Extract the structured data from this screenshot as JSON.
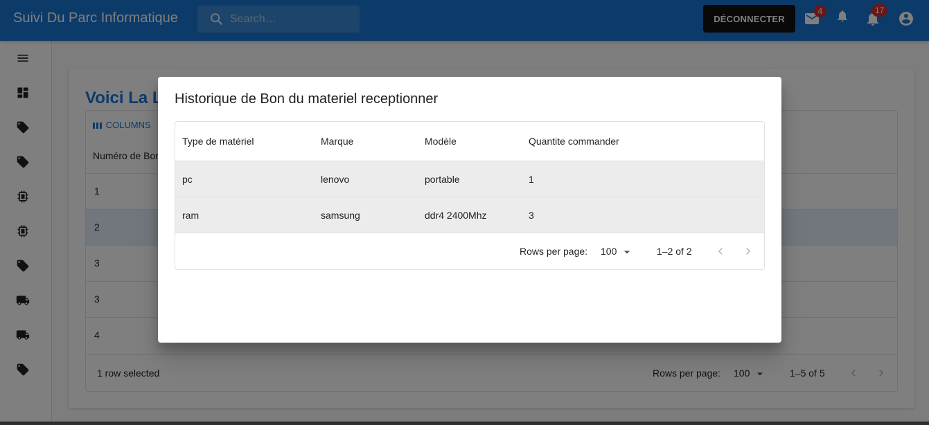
{
  "app": {
    "title": "Suivi Du Parc Informatique",
    "search_placeholder": "Search…",
    "logout_label": "DÉCONNECTER",
    "mail_badge": "4",
    "notifications_badge": "17"
  },
  "page": {
    "title": "Voici La L",
    "columns_label": "COLUMNS",
    "column_header": "Numéro de Bon",
    "rows": [
      "1",
      "2",
      "3",
      "3",
      "4"
    ],
    "selected_text": "1 row selected",
    "rows_per_page_label": "Rows per page:",
    "rows_per_page_value": "100",
    "pagination": "1–5 of 5"
  },
  "dialog": {
    "title": "Historique de Bon du materiel receptionner",
    "columns": [
      "Type de matériel",
      "Marque",
      "Modèle",
      "Quantite commander"
    ],
    "rows": [
      [
        "pc",
        "lenovo",
        "portable",
        "1"
      ],
      [
        "ram",
        "samsung",
        "ddr4 2400Mhz",
        "3"
      ]
    ],
    "rows_per_page_label": "Rows per page:",
    "rows_per_page_value": "100",
    "pagination": "1–2 of 2"
  },
  "colors": {
    "primary": "#1976d2",
    "badge": "#d32f2f"
  }
}
